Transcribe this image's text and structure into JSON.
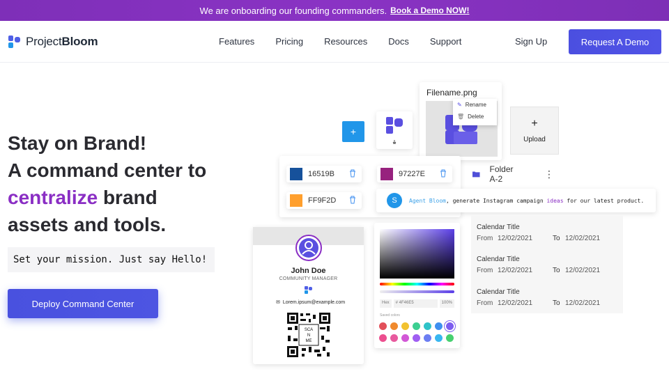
{
  "announcement": {
    "text": "We are onboarding our founding commanders.",
    "link": "Book a Demo NOW!"
  },
  "brand": {
    "name_light": "Project",
    "name_bold": "Bloom",
    "colors": {
      "primary": "#4f46e5",
      "accent": "#8a2ec4",
      "info": "#2196e9"
    }
  },
  "nav": {
    "items": [
      {
        "label": "Features"
      },
      {
        "label": "Pricing"
      },
      {
        "label": "Resources"
      },
      {
        "label": "Docs"
      },
      {
        "label": "Support"
      }
    ],
    "signup": "Sign Up",
    "cta": "Request A Demo"
  },
  "hero": {
    "line1": "Stay on Brand!",
    "line2": "A command center to",
    "accent_word": "centralize",
    "line3_rest": " brand",
    "line4": "assets and tools.",
    "tagline": "Set your mission. Just say Hello!",
    "button": "Deploy Command Center"
  },
  "showcase": {
    "add_label": "+",
    "file": {
      "name": "Filename.png",
      "menu": [
        "Rename",
        "Delete"
      ]
    },
    "upload": {
      "icon": "+",
      "label": "Upload"
    },
    "swatches": [
      {
        "hex": "16519B",
        "color": "#16519B"
      },
      {
        "hex": "97227E",
        "color": "#97227E"
      },
      {
        "hex": "FF9F2D",
        "color": "#FF9F2D"
      }
    ],
    "folder": "Folder A-2",
    "agent": {
      "initial": "S",
      "name": "Agent Bloom",
      "text_a": ", generate Instagram campaign ",
      "highlight": "ideas",
      "text_b": " for our latest product."
    },
    "contact": {
      "name": "John Doe",
      "role": "COMMUNITY MANAGER",
      "email": "Lorem.ipsum@example.com",
      "qr_text": [
        "SCA",
        "N",
        "ME"
      ]
    },
    "picker": {
      "mode": "Hex",
      "value": "# 4F46E5",
      "alpha": "100%",
      "saved_label": "Saved colors",
      "colors": [
        "#e2505a",
        "#f08a2e",
        "#f2c230",
        "#3ccf91",
        "#2fc3c8",
        "#3f8ff0",
        "#7c5cf0",
        "#ec4f8f",
        "#e85a9e",
        "#d258d6",
        "#a05ef2",
        "#6c7ef2",
        "#38b6f0",
        "#47d070"
      ]
    },
    "calendar": [
      {
        "title": "Calendar Title",
        "from_label": "From",
        "from": "12/02/2021",
        "to_label": "To",
        "to": "12/02/2021"
      },
      {
        "title": "Calendar Title",
        "from_label": "From",
        "from": "12/02/2021",
        "to_label": "To",
        "to": "12/02/2021"
      },
      {
        "title": "Calendar Title",
        "from_label": "From",
        "from": "12/02/2021",
        "to_label": "To",
        "to": "12/02/2021"
      }
    ]
  }
}
